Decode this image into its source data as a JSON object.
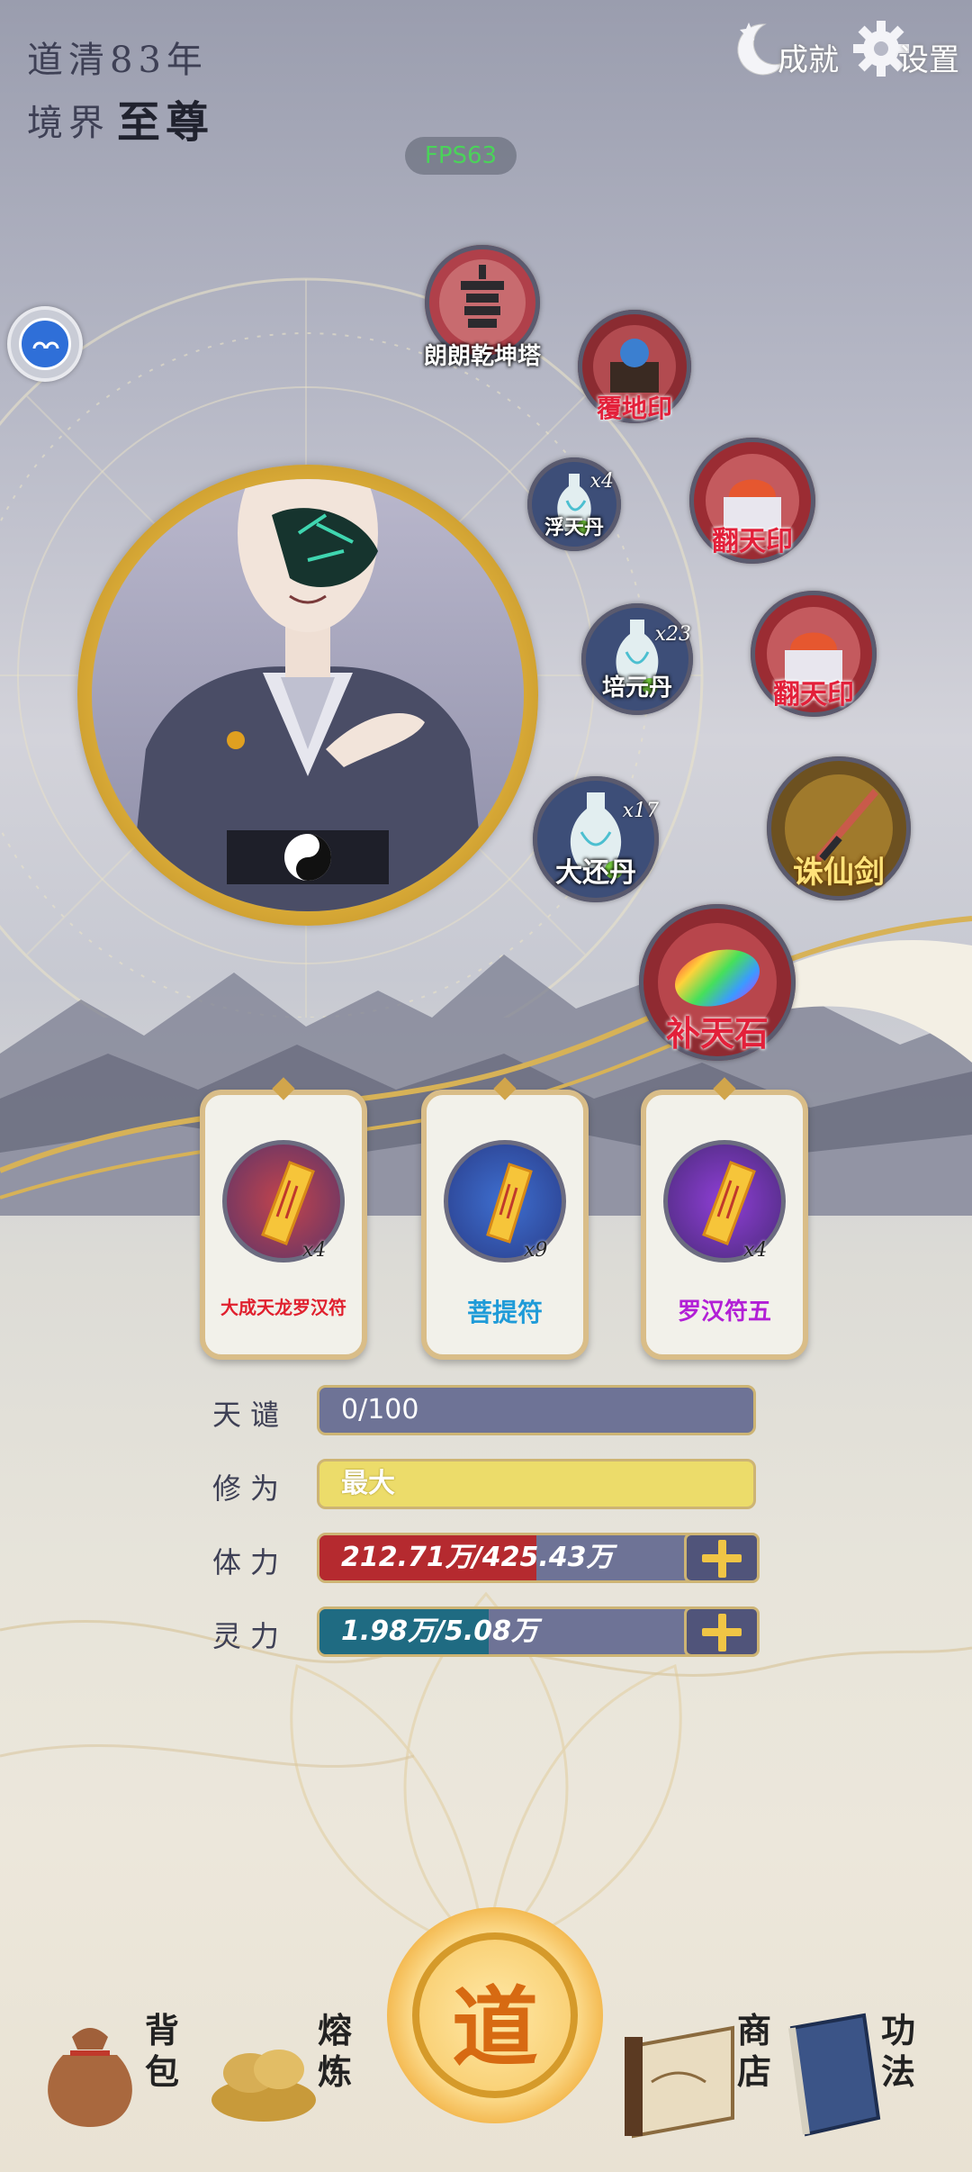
{
  "header": {
    "year_text": "道清83年",
    "realm_label": "境界",
    "realm_value": "至尊",
    "fps": "FPS63",
    "achievements_label": "成就",
    "settings_label": "设置"
  },
  "items": [
    {
      "name": "朗朗乾坤塔",
      "count": "",
      "style": "red",
      "icon": "pagoda-icon"
    },
    {
      "name": "覆地印",
      "count": "",
      "style": "red",
      "icon": "seal-icon"
    },
    {
      "name": "浮天丹",
      "count": "x4",
      "style": "white",
      "icon": "vase-icon"
    },
    {
      "name": "翻天印",
      "count": "",
      "style": "red",
      "icon": "seal-icon"
    },
    {
      "name": "培元丹",
      "count": "x23",
      "style": "white",
      "icon": "vase-icon"
    },
    {
      "name": "翻天印",
      "count": "",
      "style": "red",
      "icon": "seal-icon"
    },
    {
      "name": "大还丹",
      "count": "x17",
      "style": "white",
      "icon": "vase-icon"
    },
    {
      "name": "诛仙剑",
      "count": "",
      "style": "gold",
      "icon": "sword-icon"
    },
    {
      "name": "补天石",
      "count": "",
      "style": "red",
      "icon": "rainbow-stone-icon"
    }
  ],
  "talismans": [
    {
      "name": "大成天龙罗汉符",
      "count": "x4",
      "color": "#e0202e"
    },
    {
      "name": "菩提符",
      "count": "x9",
      "color": "#1f9bd8"
    },
    {
      "name": "罗汉符五",
      "count": "x4",
      "color": "#b21fd6"
    }
  ],
  "stats": {
    "tianqian_label": "天谴",
    "tianqian_value": "0/100",
    "tianqian_fill": 0,
    "xiuli_label": "修为",
    "xiuli_value": "最大",
    "xiuli_fill": 1.0,
    "tili_label": "体力",
    "tili_value": "212.71万/425.43万",
    "tili_fill": 0.5,
    "lingli_label": "灵力",
    "lingli_value": "1.98万/5.08万",
    "lingli_fill": 0.39
  },
  "colors": {
    "tili_fill": "#b52a2f",
    "lingli_fill": "#1f6b82",
    "bar_bg": "#6e7396",
    "gold": "#cdb474"
  },
  "nav": {
    "bag": "背包",
    "smelt": "熔炼",
    "dao": "道",
    "shop": "商店",
    "skills": "功法"
  }
}
